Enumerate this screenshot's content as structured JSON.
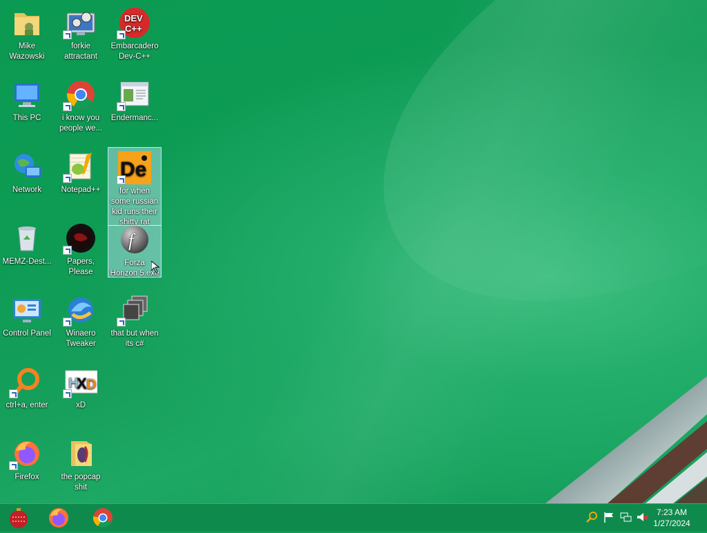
{
  "desktop": {
    "icons": [
      {
        "name": "mike-wazowski-folder",
        "label": "Mike Wazowski",
        "icon": "folder-icon"
      },
      {
        "name": "forkie-attractant-shortcut",
        "label": "forkie attractant",
        "icon": "gear-monitor-icon"
      },
      {
        "name": "embarcadero-devcpp-shortcut",
        "label": "Embarcadero Dev-C++",
        "icon": "devcpp-icon"
      },
      {
        "name": "this-pc",
        "label": "This PC",
        "icon": "computer-icon"
      },
      {
        "name": "chrome-shortcut",
        "label": "i know you people we...",
        "icon": "chrome-icon"
      },
      {
        "name": "endermanch-shortcut",
        "label": "Endermanc...",
        "icon": "window-app-icon"
      },
      {
        "name": "network",
        "label": "Network",
        "icon": "network-globe-icon"
      },
      {
        "name": "notepadpp-shortcut",
        "label": "Notepad++",
        "icon": "notepadpp-icon"
      },
      {
        "name": "de-shortcut",
        "label": "for when some russian kid runs their shitty rat",
        "icon": "de-app-icon"
      },
      {
        "name": "memz-destructive",
        "label": "MEMZ-Dest...",
        "icon": "recycle-bin-icon"
      },
      {
        "name": "papers-please-shortcut",
        "label": "Papers, Please",
        "icon": "papers-please-icon"
      },
      {
        "name": "forza-horizon-exe",
        "label": "Forza Horizon 5.exe",
        "icon": "flash-icon"
      },
      {
        "name": "control-panel",
        "label": "Control Panel",
        "icon": "control-panel-icon"
      },
      {
        "name": "winaero-tweaker-shortcut",
        "label": "Winaero Tweaker",
        "icon": "winaero-icon"
      },
      {
        "name": "csharp-shortcut",
        "label": "that but when its c#",
        "icon": "stacked-windows-icon"
      },
      {
        "name": "ctrl-a-enter-shortcut",
        "label": "ctrl+a, enter",
        "icon": "orange-ring-icon"
      },
      {
        "name": "hxd-shortcut",
        "label": "xD",
        "icon": "hxd-icon"
      },
      {
        "name": "firefox-shortcut",
        "label": "Firefox",
        "icon": "firefox-icon"
      },
      {
        "name": "popcap-folder",
        "label": "the popcap shit",
        "icon": "folder-icon"
      }
    ]
  },
  "taskbar": {
    "start_icon": "ornament-start-icon",
    "pinned": [
      {
        "name": "firefox",
        "icon": "firefox-icon"
      },
      {
        "name": "chrome",
        "icon": "chrome-icon"
      }
    ],
    "tray": [
      {
        "name": "search",
        "icon": "magnifier-icon"
      },
      {
        "name": "action-center",
        "icon": "flag-icon"
      },
      {
        "name": "network",
        "icon": "network-icon"
      },
      {
        "name": "volume",
        "icon": "volume-muted-icon"
      }
    ],
    "clock": {
      "time": "7:23 AM",
      "date": "1/27/2024"
    }
  }
}
